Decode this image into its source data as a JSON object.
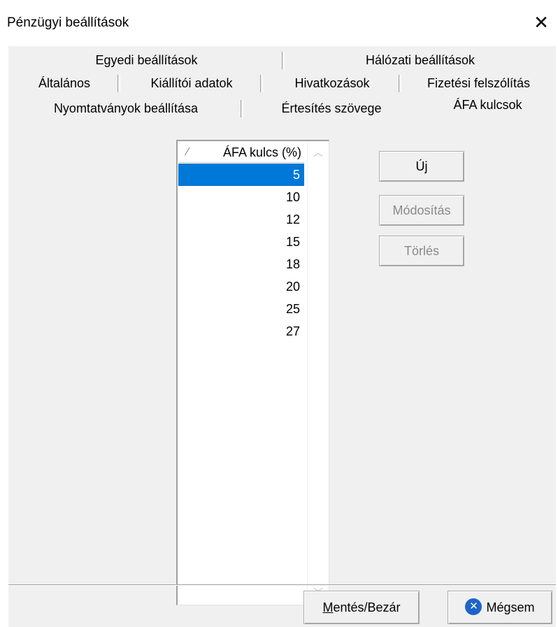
{
  "window": {
    "title": "Pénzügyi beállítások"
  },
  "tabs": {
    "row1": [
      {
        "label": "Egyedi beállítások"
      },
      {
        "label": "Hálózati beállítások"
      }
    ],
    "row2": [
      {
        "label": "Általános"
      },
      {
        "label": "Kiállítói adatok"
      },
      {
        "label": "Hivatkozások"
      },
      {
        "label": "Fizetési felszólítás"
      }
    ],
    "row3": [
      {
        "label": "Nyomtatványok beállítása"
      },
      {
        "label": "Értesítés szövege"
      },
      {
        "label": "ÁFA kulcsok",
        "active": true
      }
    ]
  },
  "vat_list": {
    "column_header": "ÁFA kulcs (%)",
    "rows": [
      "5",
      "10",
      "12",
      "15",
      "18",
      "20",
      "25",
      "27"
    ],
    "selected_index": 0
  },
  "buttons": {
    "new_label": "Új",
    "modify_label": "Módosítás",
    "delete_label": "Törlés"
  },
  "footer": {
    "save_close_underlined": "M",
    "save_close_rest": "entés/Bezár",
    "cancel_label": "Mégsem"
  },
  "icons": {
    "close": "close-icon",
    "sort": "sort-icon",
    "cancel": "cancel-x-icon"
  },
  "colors": {
    "selection": "#0078d7",
    "cancel_icon": "#1e64c8"
  }
}
